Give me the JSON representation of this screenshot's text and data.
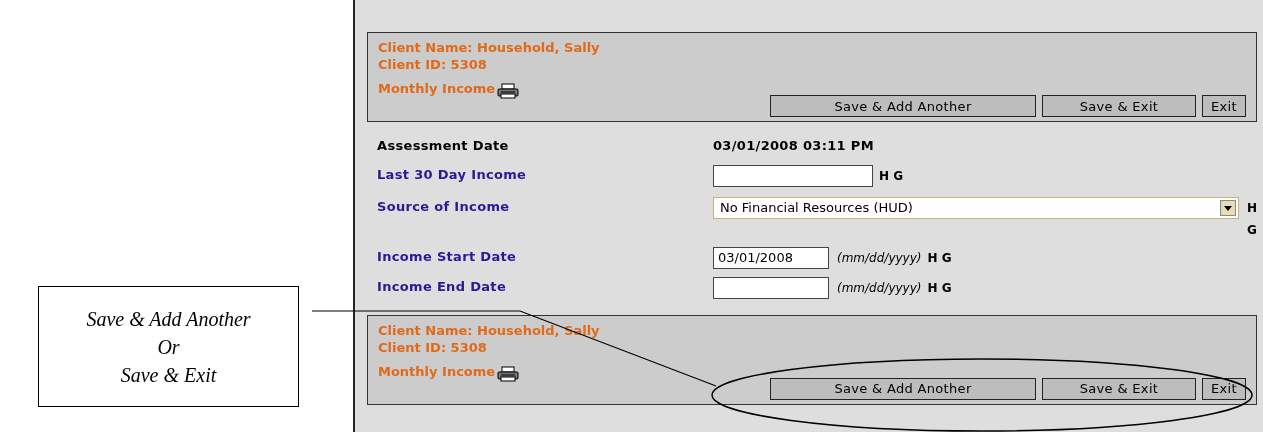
{
  "callout": {
    "lines": [
      "Save & Add Another",
      "Or",
      "Save & Exit"
    ]
  },
  "top_panel": {
    "client_name": "Client Name: Household, Sally",
    "client_id": "Client ID: 5308",
    "title": "Monthly Income",
    "buttons": [
      "Save & Add Another",
      "Save & Exit",
      "Exit"
    ]
  },
  "fields": [
    {
      "kind": "static",
      "label": "Assessment Date",
      "value": "03/01/2008 03:11 PM"
    },
    {
      "kind": "input",
      "label": "Last 30 Day Income",
      "tags": "H G"
    },
    {
      "kind": "select",
      "label": "Source of Income",
      "value": "No Financial Resources (HUD)",
      "tags": "H G"
    },
    {
      "kind": "date",
      "label": "Income Start Date",
      "value": "03/01/2008",
      "hint": "(mm/dd/yyyy)",
      "tags": "H G"
    },
    {
      "kind": "date",
      "label": "Income End Date",
      "hint": "(mm/dd/yyyy)",
      "tags": "H G"
    }
  ],
  "bottom_panel": {
    "client_name": "Client Name: Household, Sally",
    "client_id": "Client ID: 5308",
    "title": "Monthly Income",
    "buttons": [
      "Save & Add Another",
      "Save & Exit",
      "Exit"
    ]
  }
}
